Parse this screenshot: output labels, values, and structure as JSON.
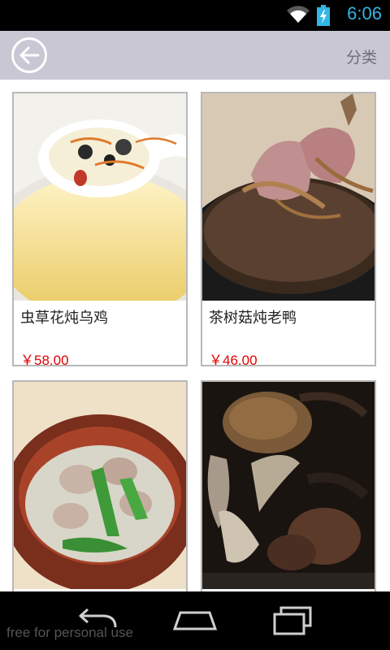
{
  "status_bar": {
    "time": "6:06",
    "icons": [
      "wifi-icon",
      "battery-charging-icon"
    ],
    "accent_color": "#33b5e5"
  },
  "header": {
    "back_icon": "back-arrow-icon",
    "category_label": "分类",
    "background_color": "#c9c7d3"
  },
  "products": [
    {
      "name": "虫草花炖乌鸡",
      "price": "￥58.00"
    },
    {
      "name": "茶树菇炖老鸭",
      "price": "￥46.00"
    },
    {
      "name": "",
      "price": ""
    },
    {
      "name": "",
      "price": ""
    }
  ],
  "price_color": "#e30000",
  "nav_bar": {
    "buttons": [
      "back-nav-icon",
      "home-nav-icon",
      "recents-nav-icon"
    ]
  },
  "watermark": "free for personal use"
}
